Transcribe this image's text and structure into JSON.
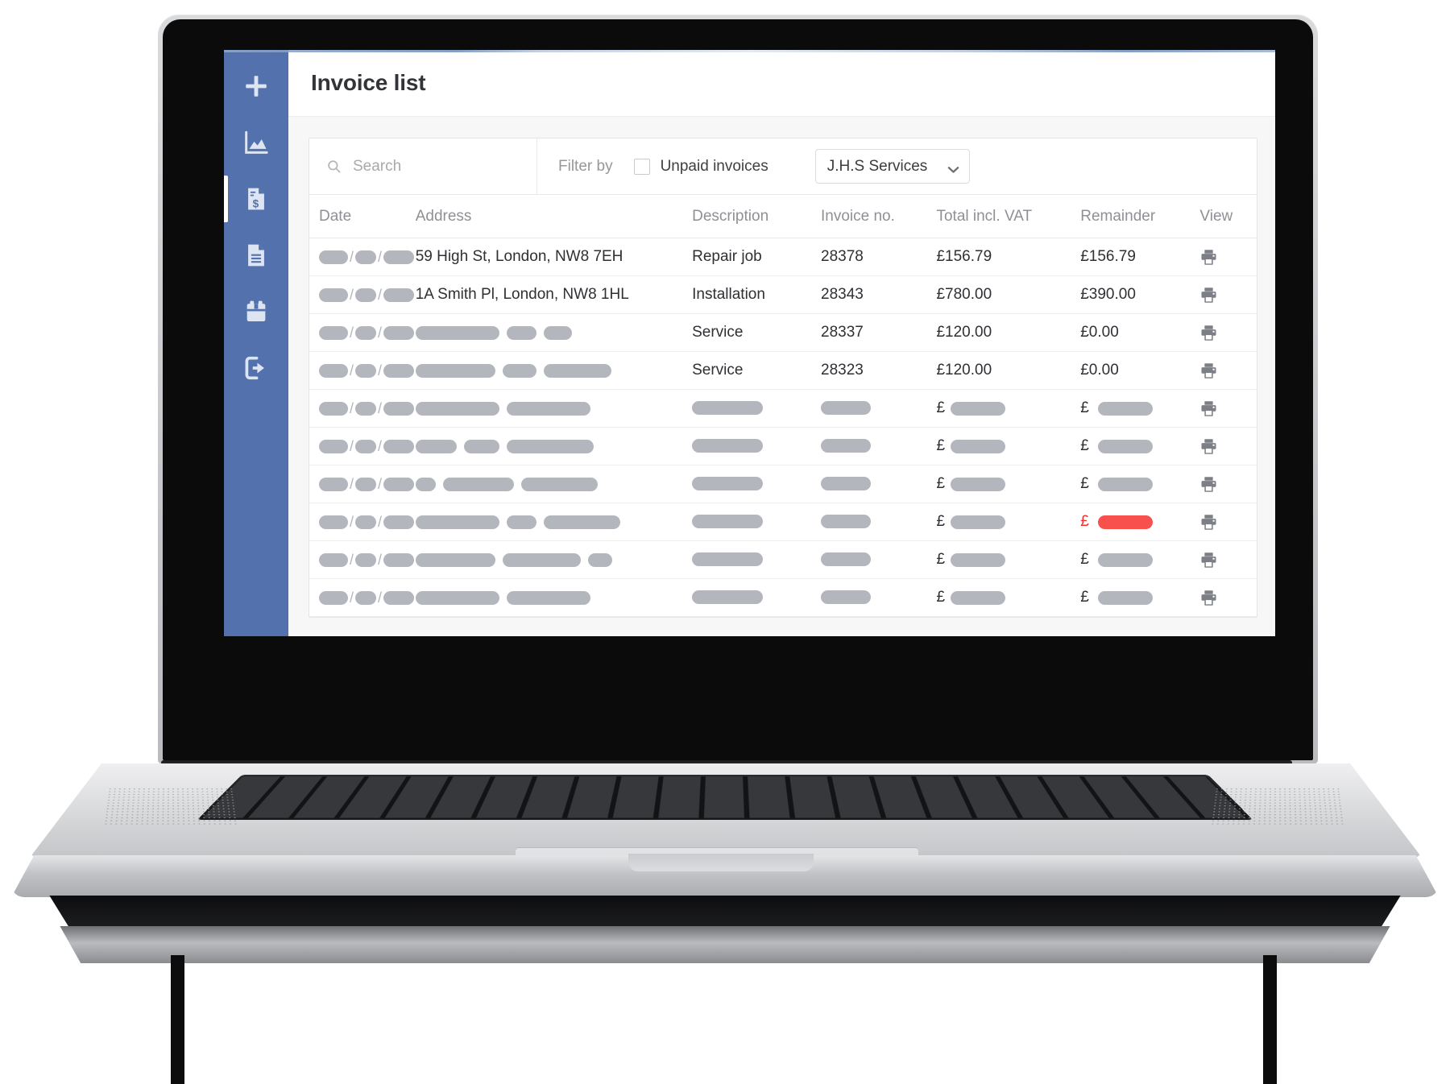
{
  "app": {
    "title": "Invoice list",
    "accent_color": "#5372ad",
    "danger_color": "#f0322e",
    "redaction_color": "#b3b7bd"
  },
  "sidebar": {
    "items": [
      {
        "name": "add-new",
        "icon": "plus-icon",
        "active": false
      },
      {
        "name": "reports",
        "icon": "chart-icon",
        "active": false
      },
      {
        "name": "invoices",
        "icon": "invoice-dollar-icon",
        "active": true
      },
      {
        "name": "documents",
        "icon": "document-icon",
        "active": false
      },
      {
        "name": "calendar",
        "icon": "calendar-icon",
        "active": false
      },
      {
        "name": "logout",
        "icon": "logout-icon",
        "active": false
      }
    ]
  },
  "toolbar": {
    "search_placeholder": "Search",
    "search_value": "",
    "search_icon": "search-icon",
    "filter_label": "Filter by",
    "unpaid_label": "Unpaid invoices",
    "unpaid_checked": false,
    "company_selected": "J.H.S Services",
    "company_options": [
      "J.H.S Services"
    ],
    "caret_icon": "chevron-down-icon"
  },
  "table": {
    "columns": [
      {
        "key": "date",
        "label": "Date"
      },
      {
        "key": "address",
        "label": "Address"
      },
      {
        "key": "description",
        "label": "Description"
      },
      {
        "key": "invoice_no",
        "label": "Invoice no."
      },
      {
        "key": "total",
        "label": "Total incl. VAT"
      },
      {
        "key": "remainder",
        "label": "Remainder"
      },
      {
        "key": "view",
        "label": "View"
      }
    ],
    "view_icon": "print-icon",
    "rows": [
      {
        "date_redacted": [
          36,
          26,
          38
        ],
        "address": "59 High St, London, NW8 7EH",
        "description": "Repair job",
        "invoice_no": "28378",
        "total": "£156.79",
        "remainder": "£156.79",
        "remainder_overdue": true
      },
      {
        "date_redacted": [
          36,
          26,
          38
        ],
        "address": "1A Smith Pl, London, NW8 1HL",
        "description": "Installation",
        "invoice_no": "28343",
        "total": "£780.00",
        "remainder": "£390.00",
        "remainder_overdue": true
      },
      {
        "date_redacted": [
          36,
          26,
          38
        ],
        "address_redacted": [
          104,
          37,
          35
        ],
        "description": "Service",
        "invoice_no": "28337",
        "total": "£120.00",
        "remainder": "£0.00",
        "remainder_overdue": false
      },
      {
        "date_redacted": [
          36,
          26,
          38
        ],
        "address_redacted": [
          99,
          42,
          84
        ],
        "description": "Service",
        "invoice_no": "28323",
        "total": "£120.00",
        "remainder": "£0.00",
        "remainder_overdue": false
      },
      {
        "date_redacted": [
          36,
          26,
          38
        ],
        "address_redacted": [
          104,
          104
        ],
        "desc_redacted": [
          88
        ],
        "num_redacted": [
          62
        ],
        "total_redacted": [
          68
        ],
        "rem_redacted": [
          68
        ],
        "remainder_overdue": false
      },
      {
        "date_redacted": [
          36,
          26,
          38
        ],
        "address_redacted": [
          51,
          44,
          108
        ],
        "desc_redacted": [
          88
        ],
        "num_redacted": [
          62
        ],
        "total_redacted": [
          68
        ],
        "rem_redacted": [
          68
        ],
        "remainder_overdue": false
      },
      {
        "date_redacted": [
          36,
          26,
          38
        ],
        "address_redacted": [
          25,
          88,
          95
        ],
        "desc_redacted": [
          88
        ],
        "num_redacted": [
          62
        ],
        "total_redacted": [
          68
        ],
        "rem_redacted": [
          68
        ],
        "remainder_overdue": false
      },
      {
        "date_redacted": [
          36,
          26,
          38
        ],
        "address_redacted": [
          104,
          37,
          95
        ],
        "desc_redacted": [
          88
        ],
        "num_redacted": [
          62
        ],
        "total_redacted": [
          68
        ],
        "rem_redacted": [
          68
        ],
        "remainder_overdue": true
      },
      {
        "date_redacted": [
          36,
          26,
          38
        ],
        "address_redacted": [
          99,
          97,
          30
        ],
        "desc_redacted": [
          88
        ],
        "num_redacted": [
          62
        ],
        "total_redacted": [
          68
        ],
        "rem_redacted": [
          68
        ],
        "remainder_overdue": false
      },
      {
        "date_redacted": [
          36,
          26,
          38
        ],
        "address_redacted": [
          104,
          104
        ],
        "desc_redacted": [
          88
        ],
        "num_redacted": [
          62
        ],
        "total_redacted": [
          68
        ],
        "rem_redacted": [
          68
        ],
        "remainder_overdue": false
      }
    ]
  }
}
